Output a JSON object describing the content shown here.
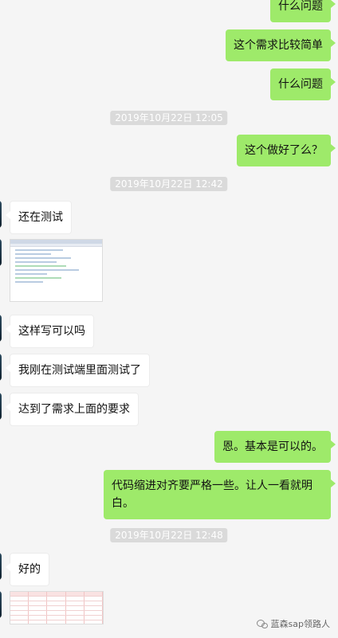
{
  "messages": [
    {
      "id": "m0",
      "side": "out",
      "text": "什么问题"
    },
    {
      "id": "m1",
      "side": "out",
      "text": "这个需求比较简单"
    },
    {
      "id": "m2",
      "side": "out",
      "text": "什么问题"
    },
    {
      "id": "t1",
      "type": "time",
      "text": "2019年10月22日 12:05"
    },
    {
      "id": "m3",
      "side": "out",
      "text": "这个做好了么？"
    },
    {
      "id": "t2",
      "type": "time",
      "text": "2019年10月22日 12:42"
    },
    {
      "id": "m4",
      "side": "in",
      "text": "还在测试"
    },
    {
      "id": "m5",
      "side": "in",
      "type": "image",
      "image": "code-screenshot"
    },
    {
      "id": "m6",
      "side": "in",
      "text": "这样写可以吗"
    },
    {
      "id": "m7",
      "side": "in",
      "text": "我刚在测试端里面测试了"
    },
    {
      "id": "m8",
      "side": "in",
      "text": "达到了需求上面的要求"
    },
    {
      "id": "m9",
      "side": "out",
      "text": "恩。基本是可以的。"
    },
    {
      "id": "m10",
      "side": "out",
      "text": "代码缩进对齐要严格一些。让人一看就明白。"
    },
    {
      "id": "t3",
      "type": "time",
      "text": "2019年10月22日 12:48"
    },
    {
      "id": "m11",
      "side": "in",
      "text": "好的"
    },
    {
      "id": "m12",
      "side": "in",
      "type": "image",
      "image": "table-screenshot"
    }
  ],
  "watermark": {
    "text": "蓝森sap领路人",
    "icon": "wechat-icon"
  },
  "colors": {
    "out_bubble": "#9eea6a",
    "in_bubble": "#ffffff",
    "background": "#f5f5f5",
    "timestamp_bg": "#dadada"
  }
}
